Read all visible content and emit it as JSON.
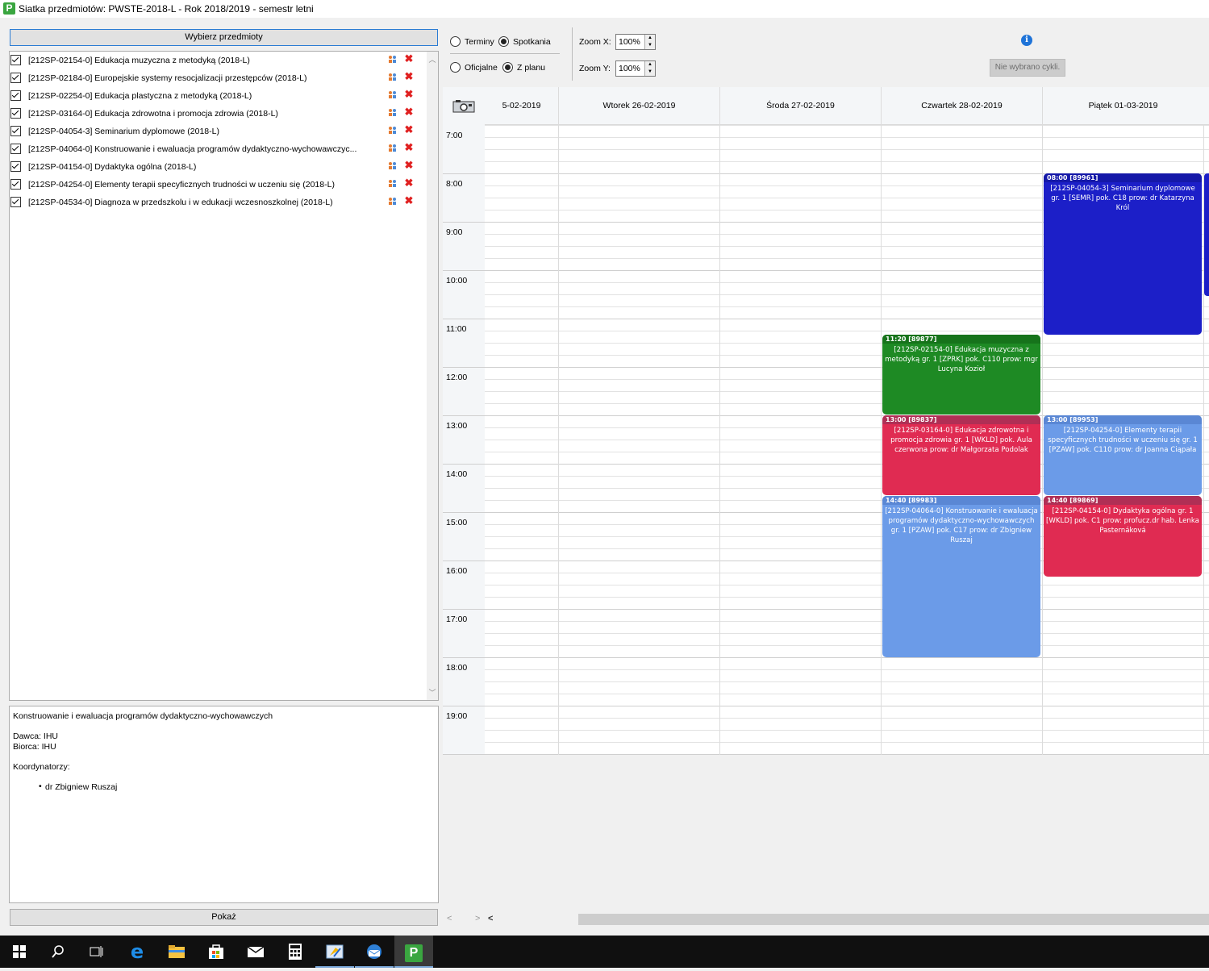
{
  "window": {
    "title": "Siatka przedmiotów: PWSTE-2018-L - Rok 2018/2019 - semestr letni",
    "app_icon_letter": "P"
  },
  "left_panel": {
    "select_button": "Wybierz przedmioty",
    "courses": [
      {
        "label": "[212SP-02154-0] Edukacja muzyczna z metodyką (2018-L)",
        "checked": true
      },
      {
        "label": "[212SP-02184-0] Europejskie systemy resocjalizacji przestępców (2018-L)",
        "checked": true
      },
      {
        "label": "[212SP-02254-0] Edukacja plastyczna z metodyką (2018-L)",
        "checked": true
      },
      {
        "label": "[212SP-03164-0] Edukacja zdrowotna i promocja zdrowia (2018-L)",
        "checked": true
      },
      {
        "label": "[212SP-04054-3] Seminarium dyplomowe (2018-L)",
        "checked": true
      },
      {
        "label": "[212SP-04064-0] Konstruowanie i ewaluacja programów dydaktyczno-wychowawczyc...",
        "checked": true
      },
      {
        "label": "[212SP-04154-0] Dydaktyka ogólna (2018-L)",
        "checked": true
      },
      {
        "label": "[212SP-04254-0] Elementy terapii specyficznych trudności w uczeniu się (2018-L)",
        "checked": true
      },
      {
        "label": "[212SP-04534-0] Diagnoza w przedszkolu i w edukacji wczesnoszkolnej (2018-L)",
        "checked": true
      }
    ],
    "info": {
      "title": "Konstruowanie i ewaluacja programów dydaktyczno-wychowawczych",
      "dawca": "Dawca: IHU",
      "biorca": "Biorca: IHU",
      "coordinators_label": "Koordynatorzy:",
      "coordinator": "dr Zbigniew Ruszaj"
    },
    "show_button": "Pokaż"
  },
  "toolbar": {
    "radio_terminy": "Terminy",
    "radio_spotkania": "Spotkania",
    "radio_oficjalne": "Oficjalne",
    "radio_zplanu": "Z planu",
    "zoom_x_label": "Zoom X:",
    "zoom_x_value": "100%",
    "zoom_y_label": "Zoom Y:",
    "zoom_y_value": "100%",
    "cycles_button": "Nie wybrano cykli."
  },
  "calendar": {
    "days": [
      "5-02-2019",
      "Wtorek 26-02-2019",
      "Środa 27-02-2019",
      "Czwartek 28-02-2019",
      "Piątek 01-03-2019"
    ],
    "hours": [
      "7:00",
      "8:00",
      "9:00",
      "10:00",
      "11:00",
      "12:00",
      "13:00",
      "14:00",
      "15:00",
      "16:00",
      "17:00",
      "18:00",
      "19:00"
    ],
    "events": [
      {
        "head": "08:00 [89961]",
        "body": "[212SP-04054-3] Seminarium dyplomowe gr. 1 [SEMR] pok. C18 prow: dr Katarzyna Król",
        "color": "#1c1fc8",
        "head_color": "#1518a8"
      },
      {
        "head": "11:20 [89877]",
        "body": "[212SP-02154-0] Edukacja muzyczna z metodyką gr. 1 [ZPRK] pok. C110 prow: mgr Lucyna Kozioł",
        "color": "#1e8a24",
        "head_color": "#16731b"
      },
      {
        "head": "13:00 [89837]",
        "body": "[212SP-03164-0] Edukacja zdrowotna i promocja zdrowia gr. 1 [WKLD] pok. Aula czerwona prow: dr Małgorzata Podolak",
        "color": "#e02b52",
        "head_color": "#b02f55"
      },
      {
        "head": "13:00 [89953]",
        "body": "[212SP-04254-0] Elementy terapii specyficznych trudności w uczeniu się gr. 1 [PZAW] pok. C110 prow: dr Joanna Ciąpała",
        "color": "#6b9be8",
        "head_color": "#5a87d4"
      },
      {
        "head": "14:40 [89983]",
        "body": "[212SP-04064-0] Konstruowanie i ewaluacja programów dydaktyczno-wychowawczych gr. 1 [PZAW] pok. C17 prow: dr Zbigniew Ruszaj",
        "color": "#6b9be8",
        "head_color": "#5a87d4"
      },
      {
        "head": "14:40 [89869]",
        "body": "[212SP-04154-0] Dydaktyka ogólna gr. 1 [WKLD] pok. C1 prow: profucz.dr hab. Lenka Pasternáková",
        "color": "#e02b52",
        "head_color": "#b02f55"
      }
    ]
  }
}
